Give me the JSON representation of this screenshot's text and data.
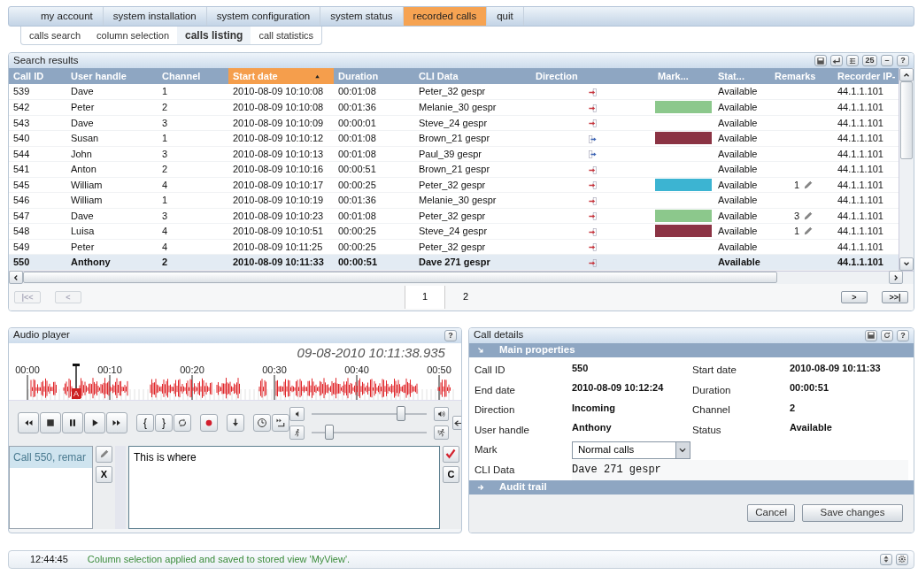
{
  "nav": {
    "tabs": [
      {
        "label": "my account",
        "selected": false
      },
      {
        "label": "system installation",
        "selected": false
      },
      {
        "label": "system configuration",
        "selected": false
      },
      {
        "label": "system status",
        "selected": false
      },
      {
        "label": "recorded calls",
        "selected": true
      },
      {
        "label": "quit",
        "selected": false
      }
    ]
  },
  "subnav": {
    "tabs": [
      {
        "label": "calls search",
        "selected": false
      },
      {
        "label": "column selection",
        "selected": false
      },
      {
        "label": "calls listing",
        "selected": true
      },
      {
        "label": "call statistics",
        "selected": false
      }
    ]
  },
  "search_results": {
    "title": "Search results",
    "tools": [
      {
        "kind": "save"
      },
      {
        "kind": "enter"
      },
      {
        "kind": "columns"
      },
      {
        "kind": "page-size",
        "label": "25"
      },
      {
        "kind": "minimize",
        "label": "–"
      },
      {
        "kind": "help",
        "label": "?"
      }
    ],
    "columns": [
      {
        "label": "Call ID",
        "sorted": false
      },
      {
        "label": "User handle",
        "sorted": false
      },
      {
        "label": "Channel",
        "sorted": false
      },
      {
        "label": "Start date",
        "sorted": true
      },
      {
        "label": "Duration",
        "sorted": false
      },
      {
        "label": "CLI Data",
        "sorted": false
      },
      {
        "label": "Direction",
        "sorted": false
      },
      {
        "label": "Mark...",
        "sorted": false
      },
      {
        "label": "Stat...",
        "sorted": false
      },
      {
        "label": "Remarks",
        "sorted": false
      },
      {
        "label": "Recorder IP-",
        "sorted": false
      }
    ],
    "rows": [
      {
        "call_id": "539",
        "user": "Dave",
        "channel": "1",
        "start": "2010-08-09 10:10:08",
        "duration": "00:01:08",
        "cli": "Peter_32 gespr",
        "kind": "in",
        "status": "Available",
        "recorder": "44.1.1.101",
        "selected": false
      },
      {
        "call_id": "542",
        "user": "Peter",
        "channel": "2",
        "start": "2010-08-09 10:10:08",
        "duration": "00:01:36",
        "cli": "Melanie_30 gespr",
        "kind": "in",
        "color": "#8cc88c",
        "status": "Available",
        "recorder": "44.1.1.101",
        "selected": false
      },
      {
        "call_id": "543",
        "user": "Dave",
        "channel": "3",
        "start": "2010-08-09 10:10:09",
        "duration": "00:00:01",
        "cli": "Steve_24 gespr",
        "kind": "in",
        "status": "Available",
        "recorder": "44.1.1.101",
        "selected": false
      },
      {
        "call_id": "540",
        "user": "Susan",
        "channel": "1",
        "start": "2010-08-09 10:10:12",
        "duration": "00:01:08",
        "cli": "Brown_21 gespr",
        "kind": "out",
        "color": "#8b3344",
        "status": "Available",
        "recorder": "44.1.1.101",
        "selected": false
      },
      {
        "call_id": "544",
        "user": "John",
        "channel": "3",
        "start": "2010-08-09 10:10:13",
        "duration": "00:01:08",
        "cli": "Paul_39 gespr",
        "kind": "out",
        "status": "Available",
        "recorder": "44.1.1.101",
        "selected": false
      },
      {
        "call_id": "541",
        "user": "Anton",
        "channel": "2",
        "start": "2010-08-09 10:10:16",
        "duration": "00:00:51",
        "cli": "Brown_21 gespr",
        "kind": "in",
        "status": "Available",
        "recorder": "44.1.1.101",
        "selected": false
      },
      {
        "call_id": "545",
        "user": "William",
        "channel": "4",
        "start": "2010-08-09 10:10:17",
        "duration": "00:00:25",
        "cli": "Peter_32 gespr",
        "kind": "in",
        "color": "#3cb4d2",
        "status": "Available",
        "remarks": "1",
        "recorder": "44.1.1.101",
        "selected": false
      },
      {
        "call_id": "546",
        "user": "William",
        "channel": "1",
        "start": "2010-08-09 10:10:19",
        "duration": "00:01:36",
        "cli": "Melanie_30 gespr",
        "kind": "in",
        "status": "Available",
        "recorder": "44.1.1.101",
        "selected": false
      },
      {
        "call_id": "547",
        "user": "Dave",
        "channel": "3",
        "start": "2010-08-09 10:10:23",
        "duration": "00:01:08",
        "cli": "Peter_32 gespr",
        "kind": "in",
        "color": "#8cc88c",
        "status": "Available",
        "remarks": "3",
        "recorder": "44.1.1.101",
        "selected": false
      },
      {
        "call_id": "548",
        "user": "Luisa",
        "channel": "4",
        "start": "2010-08-09 10:10:51",
        "duration": "00:00:25",
        "cli": "Steve_24 gespr",
        "kind": "in",
        "color": "#8b3344",
        "status": "Available",
        "remarks": "1",
        "recorder": "44.1.1.101",
        "selected": false
      },
      {
        "call_id": "549",
        "user": "Peter",
        "channel": "4",
        "start": "2010-08-09 10:11:25",
        "duration": "00:00:25",
        "cli": "Peter_32 gespr",
        "kind": "in",
        "status": "Available",
        "recorder": "44.1.1.101",
        "selected": false
      },
      {
        "call_id": "550",
        "user": "Anthony",
        "channel": "2",
        "start": "2010-08-09 10:11:33",
        "duration": "00:00:51",
        "cli": "Dave 271 gespr",
        "kind": "in",
        "status": "Available",
        "recorder": "44.1.1.101",
        "selected": true
      }
    ],
    "pager": {
      "buttons": [
        {
          "label": "|<<",
          "disabled": true
        },
        {
          "label": "<",
          "disabled": true
        },
        {
          "label": ">",
          "disabled": false
        },
        {
          "label": ">>|",
          "disabled": false
        }
      ],
      "pages": [
        {
          "label": "1",
          "selected": true
        },
        {
          "label": "2",
          "selected": false
        }
      ]
    }
  },
  "audio_player": {
    "title": "Audio player",
    "help": "?",
    "timestamp": "09-08-2010 10:11:38.935",
    "ticks": [
      "00:00",
      "00:10",
      "00:20",
      "00:30",
      "00:40",
      "00:50"
    ],
    "marker": "A",
    "transport": [
      [
        {
          "kind": "rewind"
        },
        {
          "kind": "stop"
        },
        {
          "kind": "pause"
        },
        {
          "kind": "play"
        },
        {
          "kind": "forward"
        }
      ],
      [
        {
          "kind": "mark-start",
          "label": "{"
        },
        {
          "kind": "mark-end",
          "label": "}"
        },
        {
          "kind": "loop"
        }
      ],
      [
        {
          "kind": "record"
        }
      ],
      [
        {
          "kind": "download"
        }
      ],
      [
        {
          "kind": "clock"
        },
        {
          "kind": "skip"
        }
      ]
    ],
    "volume": {
      "level": 0.78
    },
    "speed": {
      "level": 0.15
    },
    "remarks": [
      {
        "label": "Call 550, remar",
        "selected": true
      }
    ],
    "remark_tools": [
      {
        "kind": "edit"
      },
      {
        "kind": "delete",
        "label": "X"
      }
    ],
    "remark_text": "This is where",
    "confirm_tools": [
      {
        "kind": "check"
      },
      {
        "kind": "clear",
        "label": "C"
      }
    ]
  },
  "call_details": {
    "title": "Call details",
    "tools": [
      {
        "kind": "save"
      },
      {
        "kind": "refresh"
      },
      {
        "kind": "help",
        "label": "?"
      }
    ],
    "sections": [
      {
        "title": "Main properties",
        "expanded": true,
        "fields": [
          {
            "label": "Call ID",
            "value": "550",
            "kind": "text"
          },
          {
            "label": "Start date",
            "value": "2010-08-09 10:11:33",
            "kind": "text"
          },
          {
            "label": "End date",
            "value": "2010-08-09 10:12:24",
            "kind": "text"
          },
          {
            "label": "Duration",
            "value": "00:00:51",
            "kind": "text"
          },
          {
            "label": "Direction",
            "value": "Incoming",
            "kind": "text"
          },
          {
            "label": "Channel",
            "value": "2",
            "kind": "text"
          },
          {
            "label": "User handle",
            "value": "Anthony",
            "kind": "text"
          },
          {
            "label": "Status",
            "value": "Available",
            "kind": "text"
          },
          {
            "label": "Mark",
            "value": "Normal calls",
            "kind": "select"
          },
          {
            "label": "CLI Data",
            "value": "Dave 271 gespr",
            "kind": "mono"
          }
        ]
      },
      {
        "title": "Audit trail",
        "expanded": false
      }
    ],
    "buttons": [
      {
        "label": "Cancel"
      },
      {
        "label": "Save changes"
      }
    ]
  },
  "status_bar": {
    "time": "12:44:45",
    "message": "Column selection applied and saved to stored view 'MyView'.",
    "tools": [
      {
        "kind": "updown"
      },
      {
        "kind": "settings"
      }
    ]
  }
}
